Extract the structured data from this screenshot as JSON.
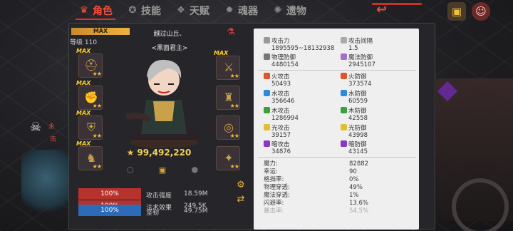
{
  "tabs": [
    {
      "label": "角色",
      "icon": "crown-icon",
      "active": true
    },
    {
      "label": "技能",
      "icon": "swirl-icon",
      "active": false
    },
    {
      "label": "天赋",
      "icon": "wings-icon",
      "active": false
    },
    {
      "label": "魂器",
      "icon": "spirit-icon",
      "active": false
    },
    {
      "label": "遗物",
      "icon": "relic-icon",
      "active": false
    }
  ],
  "hero": {
    "max_label": "MAX",
    "level": "等级 110",
    "name": "越过山丘、",
    "title": "<黑面君主>",
    "power": "99,492,220"
  },
  "equipment": {
    "max_label": "MAX",
    "stars": "★★",
    "left": [
      "gear-slot-1",
      "gear-slot-2",
      "gear-slot-3",
      "gear-slot-4"
    ],
    "right": [
      "gear-slot-5",
      "gear-slot-6",
      "gear-slot-7",
      "gear-slot-8"
    ]
  },
  "bars": [
    {
      "pct": "100%",
      "label": "攻击强度",
      "value": "18.59M",
      "color": "#b7322c"
    },
    {
      "pct": "100%",
      "label": "法术效果",
      "value": "249.5K",
      "color": "#b7322c"
    },
    {
      "pct": "100%",
      "label": "坚韧",
      "value": "49.75M",
      "color": "#2c6bb7"
    }
  ],
  "stats": {
    "attack_label": "攻击力",
    "attack_value": "1895595~18132938",
    "interval_label": "攻击间隔",
    "interval_value": "1.5",
    "phys_def_label": "物理防御",
    "phys_def_value": "4480154",
    "mag_def_label": "魔法防御",
    "mag_def_value": "2945107",
    "fire_atk_label": "火攻击",
    "fire_atk_value": "50493",
    "fire_def_label": "火防御",
    "fire_def_value": "373574",
    "water_atk_label": "水攻击",
    "water_atk_value": "356646",
    "water_def_label": "水防御",
    "water_def_value": "60559",
    "wood_atk_label": "木攻击",
    "wood_atk_value": "1286994",
    "wood_def_label": "木防御",
    "wood_def_value": "42558",
    "light_atk_label": "光攻击",
    "light_atk_value": "39157",
    "light_def_label": "光防御",
    "light_def_value": "43998",
    "dark_atk_label": "暗攻击",
    "dark_atk_value": "34876",
    "dark_def_label": "暗防御",
    "dark_def_value": "43145"
  },
  "extra": [
    {
      "label": "魔力:",
      "value": "82882"
    },
    {
      "label": "幸运:",
      "value": "90"
    },
    {
      "label": "格挡率:",
      "value": "0%"
    },
    {
      "label": "物理穿透:",
      "value": "49%"
    },
    {
      "label": "魔法穿透:",
      "value": "1%"
    },
    {
      "label": "闪避率:",
      "value": "13.6%"
    },
    {
      "label": "暴击率:",
      "value": "54.5%"
    }
  ],
  "side": {
    "label_top": "永",
    "label_bottom": "击"
  },
  "colors": {
    "accent": "#d8322a",
    "gold": "#f2d35a",
    "fire": "#e0552a",
    "water": "#2a8ae0",
    "wood": "#3aa03a",
    "light": "#e0c02a",
    "dark": "#8a3ac0"
  }
}
